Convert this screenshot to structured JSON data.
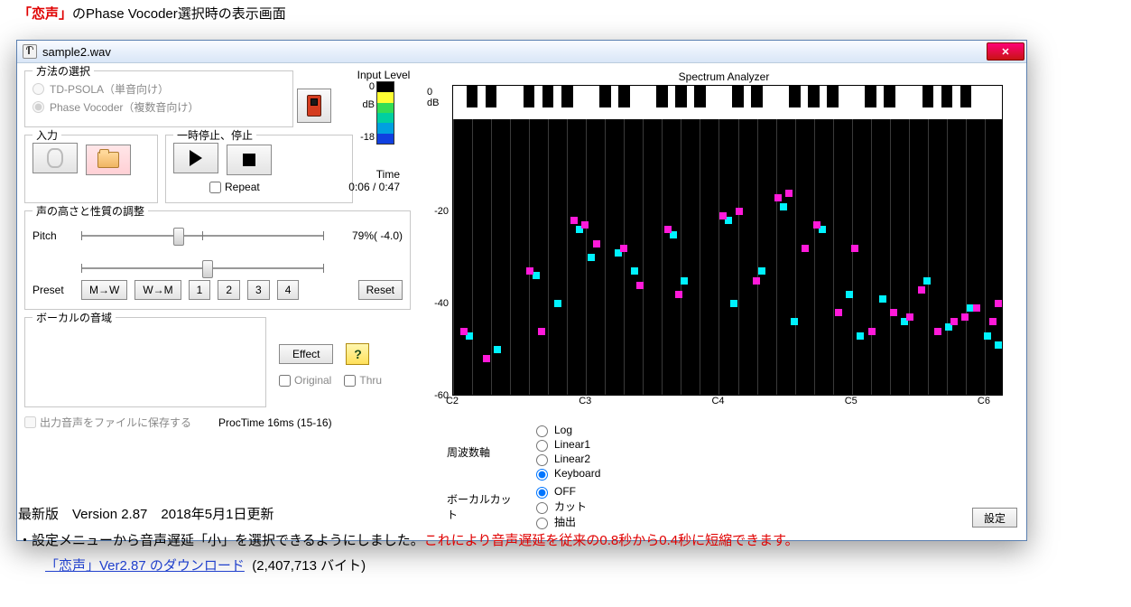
{
  "page_title_prefix": "「恋声」",
  "page_title_rest": "のPhase Vocoder選択時の表示画面",
  "window": {
    "title": "sample2.wav"
  },
  "method": {
    "legend": "方法の選択",
    "opt1": "TD-PSOLA（単音向け）",
    "opt2": "Phase Vocoder（複数音向け）"
  },
  "input": {
    "legend": "入力"
  },
  "playback": {
    "legend": "一時停止、停止",
    "repeat": "Repeat"
  },
  "meter": {
    "label": "Input Level",
    "ticks": [
      "0",
      "dB",
      "",
      "",
      "-18"
    ]
  },
  "time": {
    "label": "Time",
    "value": "0:06 / 0:47"
  },
  "pitch": {
    "legend": "声の高さと性質の調整",
    "label": "Pitch",
    "value": "79%( -4.0)",
    "preset_label": "Preset",
    "mw": "M→W",
    "wm": "W→M",
    "p1": "1",
    "p2": "2",
    "p3": "3",
    "p4": "4",
    "reset": "Reset"
  },
  "vocal": {
    "legend": "ボーカルの音域"
  },
  "effect": {
    "btn": "Effect",
    "original": "Original",
    "thru": "Thru"
  },
  "save_file": "出力音声をファイルに保存する",
  "proc": "ProcTime 16ms (15-16)",
  "analyzer": {
    "title": "Spectrum Analyzer",
    "dbunit": "dB",
    "yticks": [
      0,
      -20,
      -40,
      -60
    ],
    "xlabels": [
      "C2",
      "C3",
      "C4",
      "C5",
      "C6"
    ],
    "freq_label": "周波数軸",
    "freq_opts": [
      "Log",
      "Linear1",
      "Linear2",
      "Keyboard"
    ],
    "freq_sel": 3,
    "vcut_label": "ボーカルカット",
    "vcut_opts": [
      "OFF",
      "カット",
      "抽出"
    ],
    "vcut_sel": 0,
    "settings": "設定"
  },
  "chart_data": {
    "type": "scatter",
    "title": "Spectrum Analyzer",
    "xlabel": "",
    "ylabel": "dB",
    "ylim": [
      -60,
      0
    ],
    "xcategories": [
      "C2",
      "C3",
      "C4",
      "C5",
      "C6"
    ],
    "series": [
      {
        "name": "cyan",
        "color": "#00f2ff",
        "points": [
          [
            0.03,
            -47
          ],
          [
            0.08,
            -50
          ],
          [
            0.15,
            -34
          ],
          [
            0.19,
            -40
          ],
          [
            0.23,
            -24
          ],
          [
            0.25,
            -30
          ],
          [
            0.3,
            -29
          ],
          [
            0.33,
            -33
          ],
          [
            0.4,
            -25
          ],
          [
            0.42,
            -35
          ],
          [
            0.5,
            -22
          ],
          [
            0.51,
            -40
          ],
          [
            0.56,
            -33
          ],
          [
            0.6,
            -19
          ],
          [
            0.62,
            -44
          ],
          [
            0.67,
            -24
          ],
          [
            0.72,
            -38
          ],
          [
            0.74,
            -47
          ],
          [
            0.78,
            -39
          ],
          [
            0.82,
            -44
          ],
          [
            0.86,
            -35
          ],
          [
            0.9,
            -45
          ],
          [
            0.94,
            -41
          ],
          [
            0.97,
            -47
          ],
          [
            0.99,
            -49
          ]
        ]
      },
      {
        "name": "magenta",
        "color": "#ff1ad9",
        "points": [
          [
            0.02,
            -46
          ],
          [
            0.06,
            -52
          ],
          [
            0.14,
            -33
          ],
          [
            0.16,
            -46
          ],
          [
            0.22,
            -22
          ],
          [
            0.24,
            -23
          ],
          [
            0.26,
            -27
          ],
          [
            0.31,
            -28
          ],
          [
            0.34,
            -36
          ],
          [
            0.39,
            -24
          ],
          [
            0.41,
            -38
          ],
          [
            0.49,
            -21
          ],
          [
            0.52,
            -20
          ],
          [
            0.55,
            -35
          ],
          [
            0.59,
            -17
          ],
          [
            0.61,
            -16
          ],
          [
            0.64,
            -28
          ],
          [
            0.66,
            -23
          ],
          [
            0.7,
            -42
          ],
          [
            0.73,
            -28
          ],
          [
            0.76,
            -46
          ],
          [
            0.8,
            -42
          ],
          [
            0.83,
            -43
          ],
          [
            0.85,
            -37
          ],
          [
            0.88,
            -46
          ],
          [
            0.91,
            -44
          ],
          [
            0.93,
            -43
          ],
          [
            0.95,
            -41
          ],
          [
            0.98,
            -44
          ],
          [
            0.99,
            -40
          ]
        ]
      }
    ]
  },
  "footer": {
    "version": "最新版　Version 2.87　2018年5月1日更新",
    "note1": "・設定メニューから音声遅延「小」を選択できるようにしました。",
    "note1red": "これにより音声遅延を従来の0.8秒から0.4秒に短縮できます。",
    "link": "「恋声」Ver2.87 のダウンロード",
    "size": "(2,407,713 バイト)"
  }
}
